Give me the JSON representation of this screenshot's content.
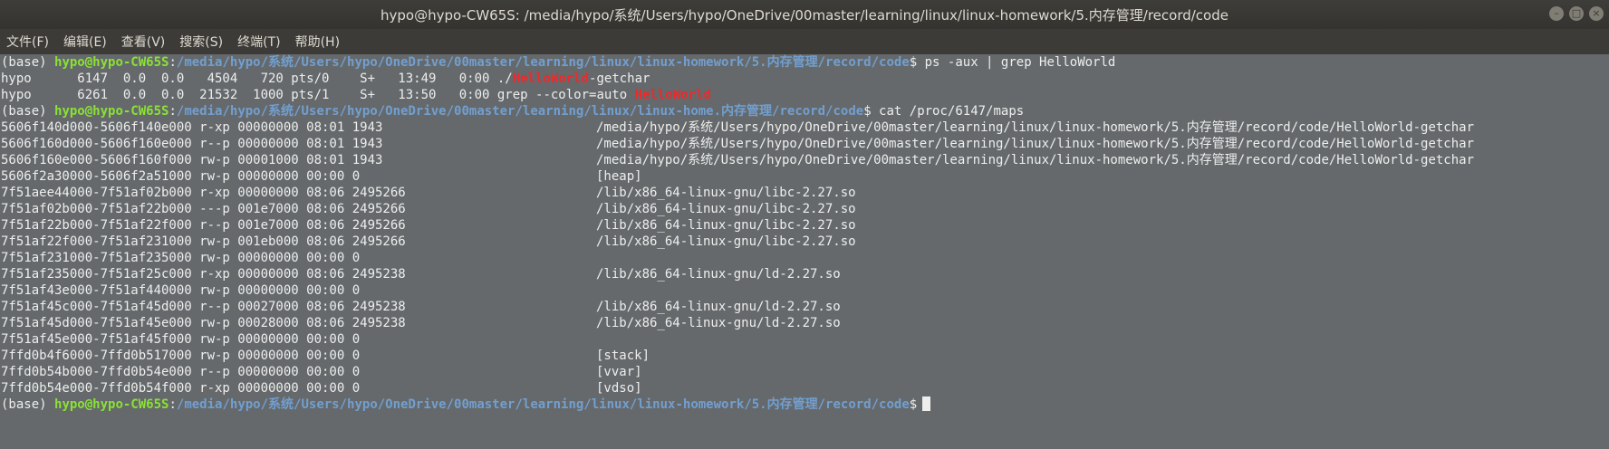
{
  "window": {
    "title": "hypo@hypo-CW65S: /media/hypo/系统/Users/hypo/OneDrive/00master/learning/linux/linux-homework/5.内存管理/record/code",
    "controls": [
      "–",
      "□",
      "×"
    ]
  },
  "menu": [
    "文件(F)",
    "编辑(E)",
    "查看(V)",
    "搜索(S)",
    "终端(T)",
    "帮助(H)"
  ],
  "prompt": {
    "env": "(base) ",
    "user": "hypo@hypo-CW65S",
    "sep": ":",
    "path": "/media/hypo/系统/Users/hypo/OneDrive/00master/learning/linux/linux-homework/5.内存管理/record/code",
    "path2": "/media/hypo/系统/Users/hypo/OneDrive/00master/learning/linux/linux-home.内存管理/record/code",
    "dollar": "$ "
  },
  "commands": {
    "c1": "ps -aux | grep HelloWorld",
    "c2": "cat /proc/6147/maps"
  },
  "ps_lines": [
    {
      "pre": "hypo      6147  0.0  0.0   4504   720 pts/0    S+   13:49   0:00 ./",
      "hl": "HelloWorld",
      "post": "-getchar"
    },
    {
      "pre": "hypo      6261  0.0  0.0  21532  1000 pts/1    S+   13:50   0:00 grep --color=auto ",
      "hl": "HelloWorld",
      "post": ""
    }
  ],
  "maps": [
    {
      "left": "5606f140d000-5606f140e000 r-xp 00000000 08:01 1943",
      "path": "/media/hypo/系统/Users/hypo/OneDrive/00master/learning/linux/linux-homework/5.内存管理/record/code/HelloWorld-getchar"
    },
    {
      "left": "5606f160d000-5606f160e000 r--p 00000000 08:01 1943",
      "path": "/media/hypo/系统/Users/hypo/OneDrive/00master/learning/linux/linux-homework/5.内存管理/record/code/HelloWorld-getchar"
    },
    {
      "left": "5606f160e000-5606f160f000 rw-p 00001000 08:01 1943",
      "path": "/media/hypo/系统/Users/hypo/OneDrive/00master/learning/linux/linux-homework/5.内存管理/record/code/HelloWorld-getchar"
    },
    {
      "left": "5606f2a30000-5606f2a51000 rw-p 00000000 00:00 0",
      "path": "[heap]"
    },
    {
      "left": "7f51aee44000-7f51af02b000 r-xp 00000000 08:06 2495266",
      "path": "/lib/x86_64-linux-gnu/libc-2.27.so"
    },
    {
      "left": "7f51af02b000-7f51af22b000 ---p 001e7000 08:06 2495266",
      "path": "/lib/x86_64-linux-gnu/libc-2.27.so"
    },
    {
      "left": "7f51af22b000-7f51af22f000 r--p 001e7000 08:06 2495266",
      "path": "/lib/x86_64-linux-gnu/libc-2.27.so"
    },
    {
      "left": "7f51af22f000-7f51af231000 rw-p 001eb000 08:06 2495266",
      "path": "/lib/x86_64-linux-gnu/libc-2.27.so"
    },
    {
      "left": "7f51af231000-7f51af235000 rw-p 00000000 00:00 0",
      "path": ""
    },
    {
      "left": "7f51af235000-7f51af25c000 r-xp 00000000 08:06 2495238",
      "path": "/lib/x86_64-linux-gnu/ld-2.27.so"
    },
    {
      "left": "7f51af43e000-7f51af440000 rw-p 00000000 00:00 0",
      "path": ""
    },
    {
      "left": "7f51af45c000-7f51af45d000 r--p 00027000 08:06 2495238",
      "path": "/lib/x86_64-linux-gnu/ld-2.27.so"
    },
    {
      "left": "7f51af45d000-7f51af45e000 rw-p 00028000 08:06 2495238",
      "path": "/lib/x86_64-linux-gnu/ld-2.27.so"
    },
    {
      "left": "7f51af45e000-7f51af45f000 rw-p 00000000 00:00 0",
      "path": ""
    },
    {
      "left": "7ffd0b4f6000-7ffd0b517000 rw-p 00000000 00:00 0",
      "path": "[stack]"
    },
    {
      "left": "7ffd0b54b000-7ffd0b54e000 r--p 00000000 00:00 0",
      "path": "[vvar]"
    },
    {
      "left": "7ffd0b54e000-7ffd0b54f000 r-xp 00000000 00:00 0",
      "path": "[vdso]"
    }
  ],
  "colors": {
    "prompt_user": "#8ae234",
    "prompt_path": "#729fcf",
    "grep_highlight": "#ef2929",
    "terminal_bg": "#65696c",
    "titlebar_bg": "#3c3b37"
  }
}
